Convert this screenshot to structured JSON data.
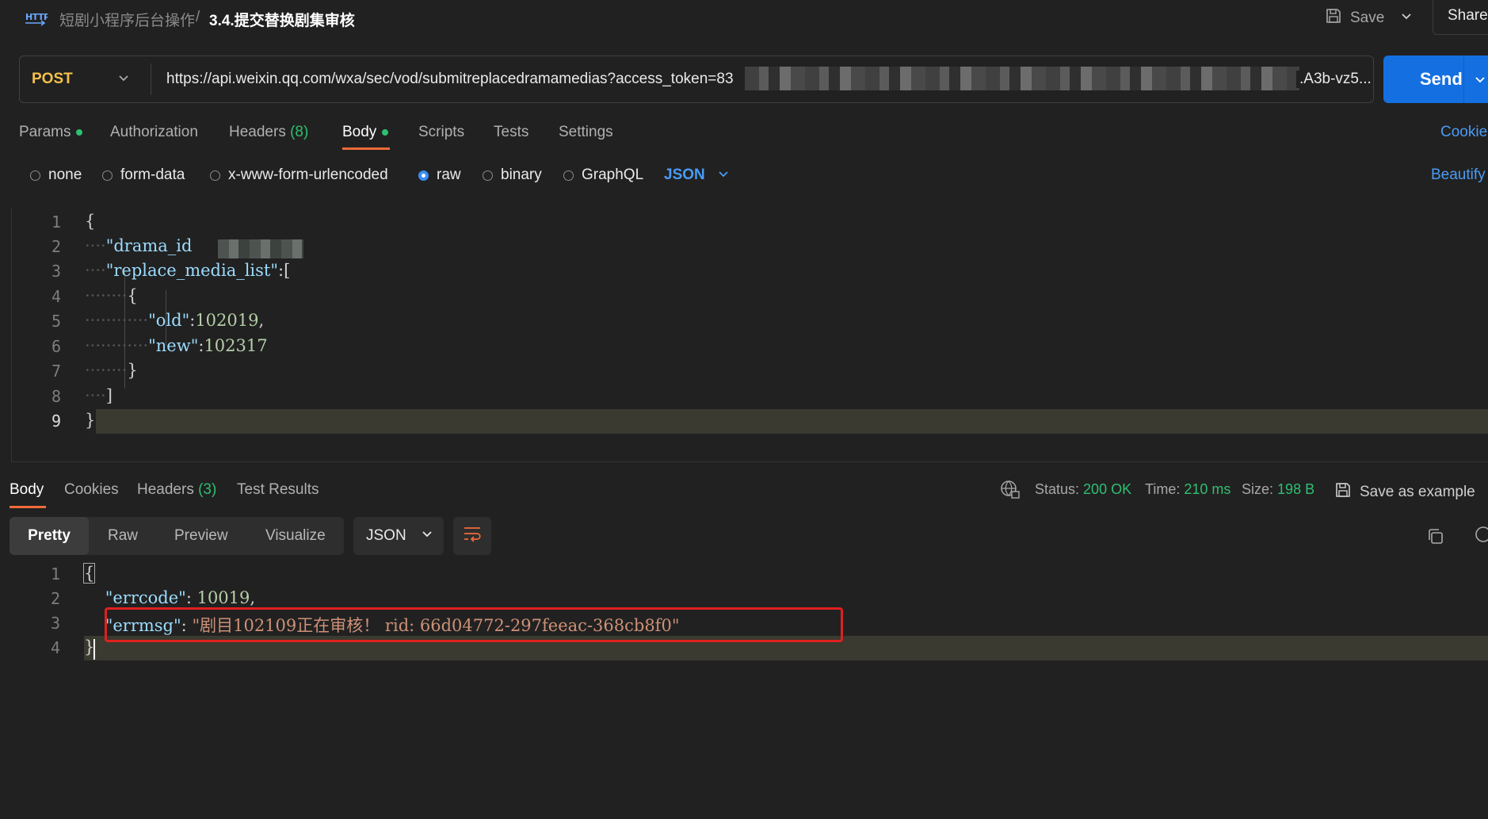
{
  "breadcrumb": {
    "icon": "http-icon",
    "icon_text": "HTTP",
    "parent": "短剧小程序后台操作",
    "separator": "/",
    "current": "3.4.提交替换剧集审核"
  },
  "header": {
    "save_label": "Save",
    "share_label": "Share"
  },
  "request": {
    "method": "POST",
    "url_visible": "https://api.weixin.qq.com/wxa/sec/vod/submitreplacedramamedias?access_token=83",
    "url_tail": ".A3b-vz5...",
    "send_label": "Send"
  },
  "request_tabs": {
    "params": "Params",
    "authorization": "Authorization",
    "headers": "Headers",
    "headers_count": "(8)",
    "body": "Body",
    "scripts": "Scripts",
    "tests": "Tests",
    "settings": "Settings",
    "cookies": "Cookie"
  },
  "body_types": {
    "none": "none",
    "form_data": "form-data",
    "urlencoded": "x-www-form-urlencoded",
    "raw": "raw",
    "binary": "binary",
    "graphql": "GraphQL",
    "selected": "raw",
    "format": "JSON",
    "beautify": "Beautify"
  },
  "request_body": {
    "line_numbers": [
      "1",
      "2",
      "3",
      "4",
      "5",
      "6",
      "7",
      "8",
      "9"
    ],
    "l1": "{",
    "l2_key": "\"drama_id",
    "l3_key": "\"replace_media_list\"",
    "l3_rest": ":[",
    "l4": "{",
    "l5_key": "\"old\"",
    "l5_val": "102019",
    "l5_end": ",",
    "l6_key": "\"new\"",
    "l6_val": "102317",
    "l7": "}",
    "l8": "]",
    "l9": "}"
  },
  "response_tabs": {
    "body": "Body",
    "cookies": "Cookies",
    "headers": "Headers",
    "headers_count": "(3)",
    "test_results": "Test Results"
  },
  "response_meta": {
    "status_label": "Status:",
    "status_value": "200 OK",
    "time_label": "Time:",
    "time_value": "210 ms",
    "size_label": "Size:",
    "size_value": "198 B",
    "save_example": "Save as example"
  },
  "response_view": {
    "pretty": "Pretty",
    "raw": "Raw",
    "preview": "Preview",
    "visualize": "Visualize",
    "format": "JSON"
  },
  "response_body": {
    "line_numbers": [
      "1",
      "2",
      "3",
      "4"
    ],
    "l1": "{",
    "l2_key": "\"errcode\"",
    "l2_val": "10019",
    "l3_key": "\"errmsg\"",
    "l3_val": "\"剧目102109正在审核！ rid: 66d04772-297feeac-368cb8f0\"",
    "l4": "}"
  },
  "colors": {
    "accent": "#f26b3a",
    "send": "#1470e0",
    "success": "#2fbf71",
    "method": "#f5c04a",
    "highlight": "#e02020"
  }
}
